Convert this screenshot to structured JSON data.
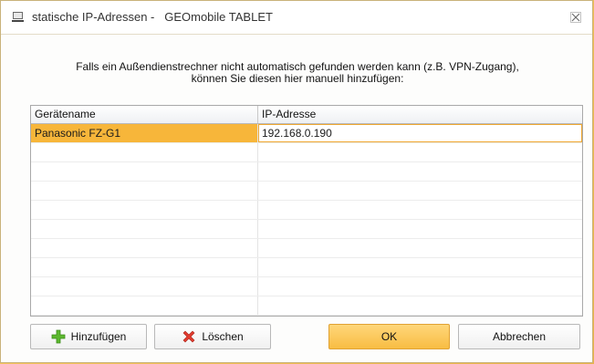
{
  "window": {
    "title": "statische IP-Adressen -   GEOmobile TABLET"
  },
  "info": {
    "line1": "Falls ein Außendienstrechner nicht automatisch gefunden werden kann (z.B. VPN-Zugang),",
    "line2": "können Sie diesen hier manuell hinzufügen:"
  },
  "table": {
    "columns": [
      "Gerätename",
      "IP-Adresse"
    ],
    "rows": [
      [
        "Panasonic FZ-G1",
        "192.168.0.190"
      ]
    ]
  },
  "buttons": {
    "add": "Hinzufügen",
    "delete": "Löschen",
    "ok": "OK",
    "cancel": "Abbrechen"
  },
  "icons": {
    "app": "app-window-icon",
    "close": "close-icon",
    "add": "plus-icon",
    "delete": "red-x-icon"
  }
}
